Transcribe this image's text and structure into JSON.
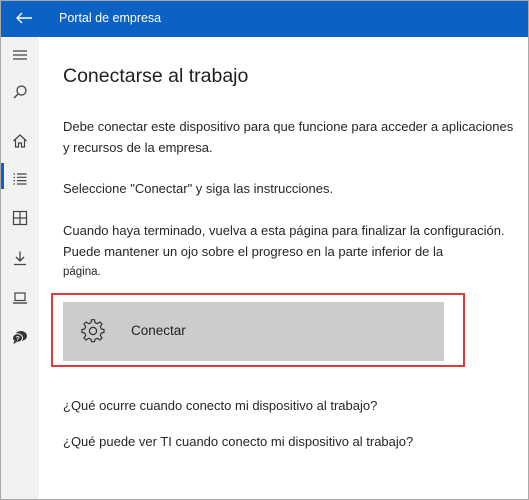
{
  "window": {
    "title": "Portal de empresa"
  },
  "sidebar": {
    "items": [
      {
        "icon": "menu-icon",
        "label": "Menú"
      },
      {
        "icon": "search-icon",
        "label": "Buscar"
      },
      {
        "icon": "home-icon",
        "label": "Inicio",
        "selected": true
      },
      {
        "icon": "list-icon",
        "label": "Aplicaciones"
      },
      {
        "icon": "categories-icon",
        "label": "Categorías"
      },
      {
        "icon": "download-icon",
        "label": "Descargas"
      },
      {
        "icon": "devices-icon",
        "label": "Dispositivos"
      },
      {
        "icon": "help-icon",
        "label": "Ayuda y soporte técnico"
      }
    ]
  },
  "main": {
    "heading": "Conectarse al trabajo",
    "paragraph1_line1": "Debe conectar este dispositivo para que funcione para acceder a aplicaciones",
    "paragraph1_line2": "y recursos de la empresa.",
    "paragraph2": "Seleccione \"Conectar\" y siga las instrucciones.",
    "paragraph3_line1": "Cuando haya terminado, vuelva a esta página para finalizar la configuración.",
    "paragraph3_line2": "Puede mantener un ojo sobre el progreso en la parte inferior de la",
    "paragraph3_line3": "página.",
    "connect_label": "Conectar",
    "link1": "¿Qué ocurre cuando conecto mi dispositivo al trabajo?",
    "link2": "¿Qué puede ver TI cuando conecto mi dispositivo al trabajo?"
  },
  "colors": {
    "accent": "#0b62c4",
    "highlight": "#e03a3e",
    "button": "#cccccc"
  }
}
